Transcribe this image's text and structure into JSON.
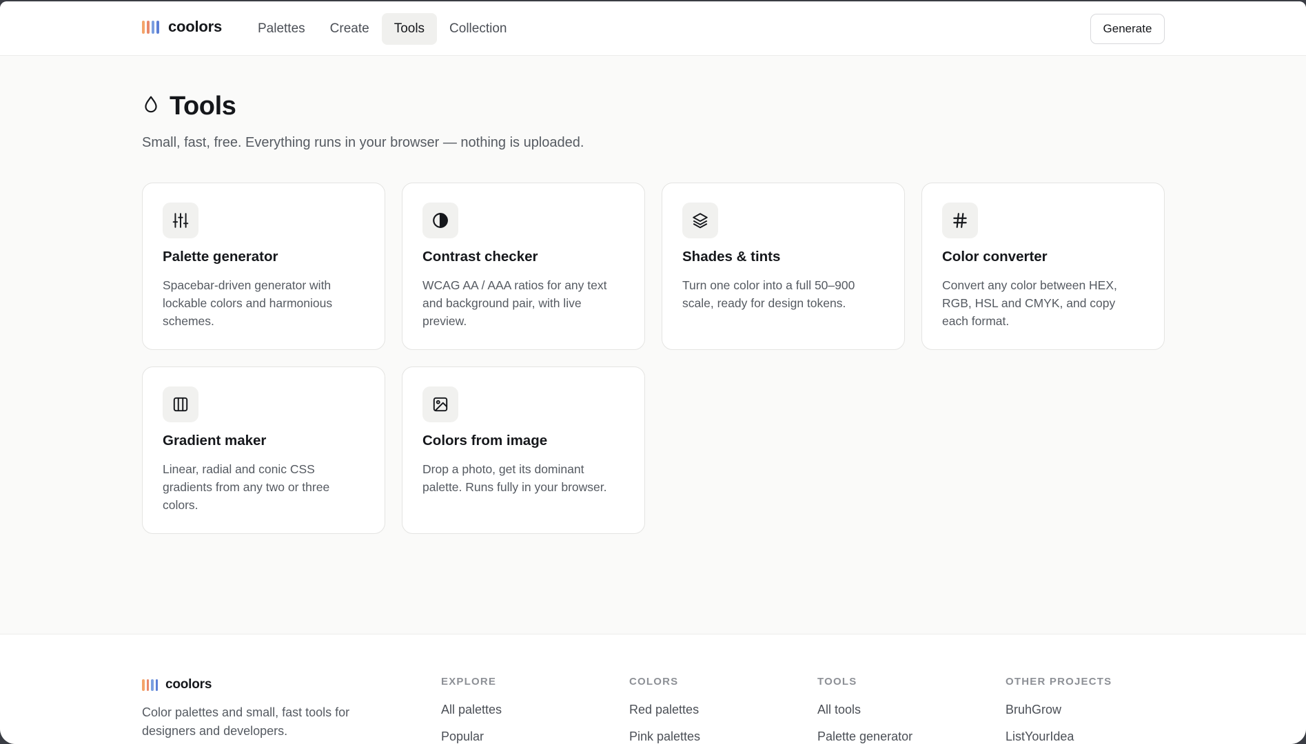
{
  "header": {
    "brand": "coolors",
    "brand_colors": [
      "#f4a56a",
      "#e8886a",
      "#7b9fe0",
      "#5b7fd6"
    ],
    "nav": [
      {
        "label": "Palettes",
        "active": false
      },
      {
        "label": "Create",
        "active": false
      },
      {
        "label": "Tools",
        "active": true
      },
      {
        "label": "Collection",
        "active": false
      }
    ],
    "generate_label": "Generate"
  },
  "page": {
    "title": "Tools",
    "title_icon": "droplet-icon",
    "subtitle": "Small, fast, free. Everything runs in your browser — nothing is uploaded."
  },
  "tools": [
    {
      "icon": "sliders-icon",
      "title": "Palette generator",
      "desc": "Spacebar-driven generator with lockable colors and harmonious schemes."
    },
    {
      "icon": "contrast-icon",
      "title": "Contrast checker",
      "desc": "WCAG AA / AAA ratios for any text and background pair, with live preview."
    },
    {
      "icon": "layers-icon",
      "title": "Shades & tints",
      "desc": "Turn one color into a full 50–900 scale, ready for design tokens."
    },
    {
      "icon": "hash-icon",
      "title": "Color converter",
      "desc": "Convert any color between HEX, RGB, HSL and CMYK, and copy each format."
    },
    {
      "icon": "gradient-icon",
      "title": "Gradient maker",
      "desc": "Linear, radial and conic CSS gradients from any two or three colors."
    },
    {
      "icon": "image-icon",
      "title": "Colors from image",
      "desc": "Drop a photo, get its dominant palette. Runs fully in your browser."
    }
  ],
  "footer": {
    "brand": "coolors",
    "tagline": "Color palettes and small, fast tools for designers and developers.",
    "columns": [
      {
        "heading": "EXPLORE",
        "links": [
          "All palettes",
          "Popular"
        ]
      },
      {
        "heading": "COLORS",
        "links": [
          "Red palettes",
          "Pink palettes"
        ]
      },
      {
        "heading": "TOOLS",
        "links": [
          "All tools",
          "Palette generator"
        ]
      },
      {
        "heading": "OTHER PROJECTS",
        "links": [
          "BruhGrow",
          "ListYourIdea"
        ]
      }
    ]
  }
}
